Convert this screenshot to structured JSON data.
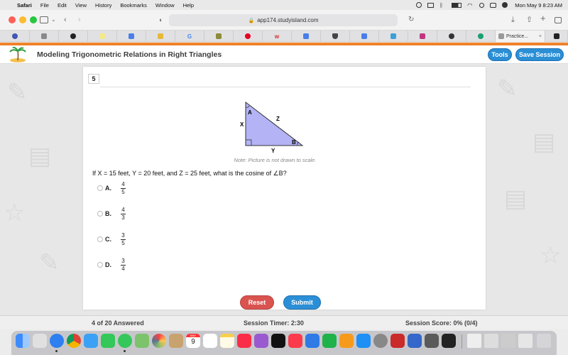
{
  "menubar": {
    "app_name": "Safari",
    "menus": [
      "File",
      "Edit",
      "View",
      "History",
      "Bookmarks",
      "Window",
      "Help"
    ],
    "datetime": "Mon May 9  8:23 AM"
  },
  "browser": {
    "address": "app174.studyisland.com",
    "active_tab_label": "Practice..."
  },
  "header": {
    "title": "Modeling Trigonometric Relations in Right Triangles",
    "tools_label": "Tools",
    "save_label": "Save Session"
  },
  "question": {
    "number": "5",
    "figure": {
      "label_a": "A",
      "label_b": "B",
      "label_x": "X",
      "label_y": "Y",
      "label_z": "Z"
    },
    "note": "Note: Picture is not drawn to scale.",
    "text": "If X = 15 feet, Y = 20 feet, and Z = 25 feet, what is the cosine of ∠B?",
    "choices": [
      {
        "letter": "A.",
        "num": "4",
        "den": "5"
      },
      {
        "letter": "B.",
        "num": "4",
        "den": "3"
      },
      {
        "letter": "C.",
        "num": "3",
        "den": "5"
      },
      {
        "letter": "D.",
        "num": "3",
        "den": "4"
      }
    ],
    "reset_label": "Reset",
    "submit_label": "Submit"
  },
  "status": {
    "answered": "4 of 20 Answered",
    "timer": "Session Timer: 2:30",
    "score": "Session Score: 0% (0/4)"
  },
  "dock": {
    "calendar_month": "MAY",
    "calendar_day": "9"
  },
  "colors": {
    "accent_blue": "#2b8fd6",
    "reset_red": "#d9534f",
    "brand_orange": "#f0822b",
    "triangle_fill": "#b3b3f5"
  }
}
